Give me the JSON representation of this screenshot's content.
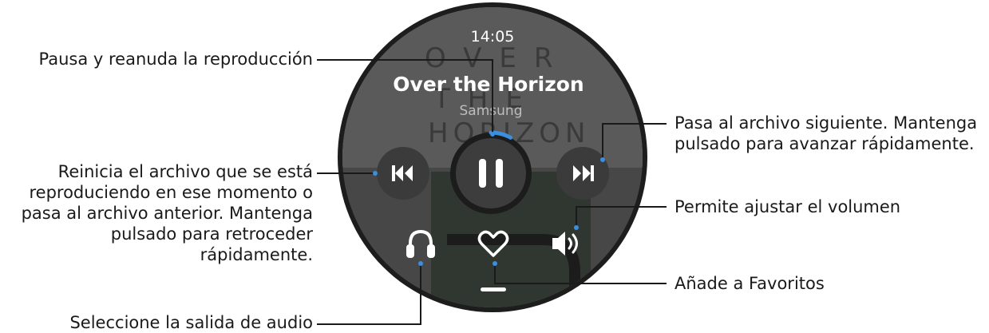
{
  "watch": {
    "time": "14:05",
    "track_title": "Over the Horizon",
    "artist": "Samsung",
    "album_art_words": [
      "OVER",
      "THE",
      "HORIZON"
    ],
    "playback_progress": 0.08,
    "accent_color": "#3a8fe0",
    "icons": {
      "previous": "skip-previous-icon",
      "play_pause": "pause-icon",
      "next": "skip-next-icon",
      "output": "headphones-icon",
      "favorite": "heart-icon",
      "volume": "volume-icon"
    }
  },
  "callouts": {
    "pause_resume": "Pausa y reanuda la reproducción",
    "next_line1": "Pasa al archivo siguiente. Mantenga",
    "next_line2": "pulsado para avanzar rápidamente.",
    "restart_line1": "Reinicia el archivo que se está",
    "restart_line2": "reproduciendo en ese momento o",
    "restart_line3": "pasa al archivo anterior. Mantenga",
    "restart_line4": "pulsado para retroceder",
    "restart_line5": "rápidamente.",
    "volume": "Permite ajustar el volumen",
    "favorites": "Añade a Favoritos",
    "audio_output": "Seleccione la salida de audio"
  }
}
